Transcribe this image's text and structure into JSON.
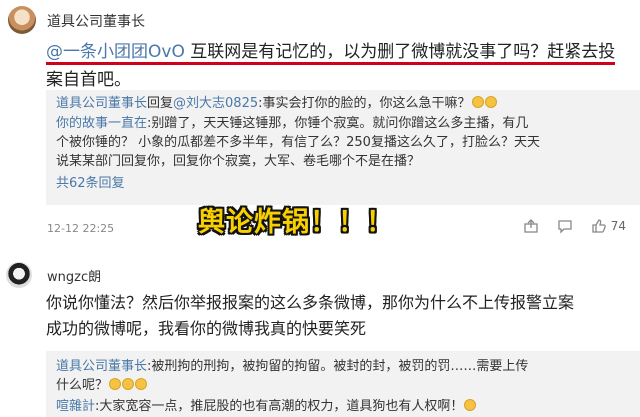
{
  "comment1": {
    "username": "道具公司董事长",
    "mention": "@一条小团团OvO",
    "text_line1": " 互联网是有记忆的，以为删了微博就没事了吗？赶紧去投",
    "text_line2": "案自首吧。",
    "replies": [
      {
        "name": "道具公司董事长",
        "action": "回复",
        "target": "@刘大志0825",
        "text": ":事实会打你的脸的，你这么急干嘛？"
      },
      {
        "name": "你的故事一直在",
        "text": ":别蹭了，天天锤这锤那，你锤个寂寞。就问你蹭这么多主播，有几"
      },
      {
        "text": "个被你锤的？ 小象的瓜都差不多半年，有信了么？250复播这么久了，打脸么？天天"
      },
      {
        "text": "说某某部门回复你，回复你个寂寞，大军、卷毛哪个不是在播？"
      }
    ],
    "more_replies": "共62条回复",
    "time": "12-12 22:25",
    "like_count": "74"
  },
  "overlay_text": "舆论炸锅！！！",
  "comment2": {
    "username": "wngzc朗",
    "text_line1": "你说你懂法？然后你举报报案的这么多条微博，那你为什么不上传报警立案",
    "text_line2": "成功的微博呢，我看你的微博我真的快要笑死",
    "replies": [
      {
        "name": "道具公司董事长",
        "text": ":被刑拘的刑拘，被拘留的拘留。被封的封，被罚的罚……需要上传"
      },
      {
        "text": "什么呢？"
      },
      {
        "name": "喧雜計",
        "text": ":大家宽容一点，推屁股的也有高潮的权力，道具狗也有人权啊！"
      }
    ]
  },
  "icons": [
    "share-icon",
    "comment-icon",
    "like-icon",
    "emoji-icon"
  ],
  "colors": {
    "link": "#4a78a8",
    "underline": "#d0021b",
    "overlay": "#f8d000",
    "reply_bg": "#f2f2f2"
  }
}
